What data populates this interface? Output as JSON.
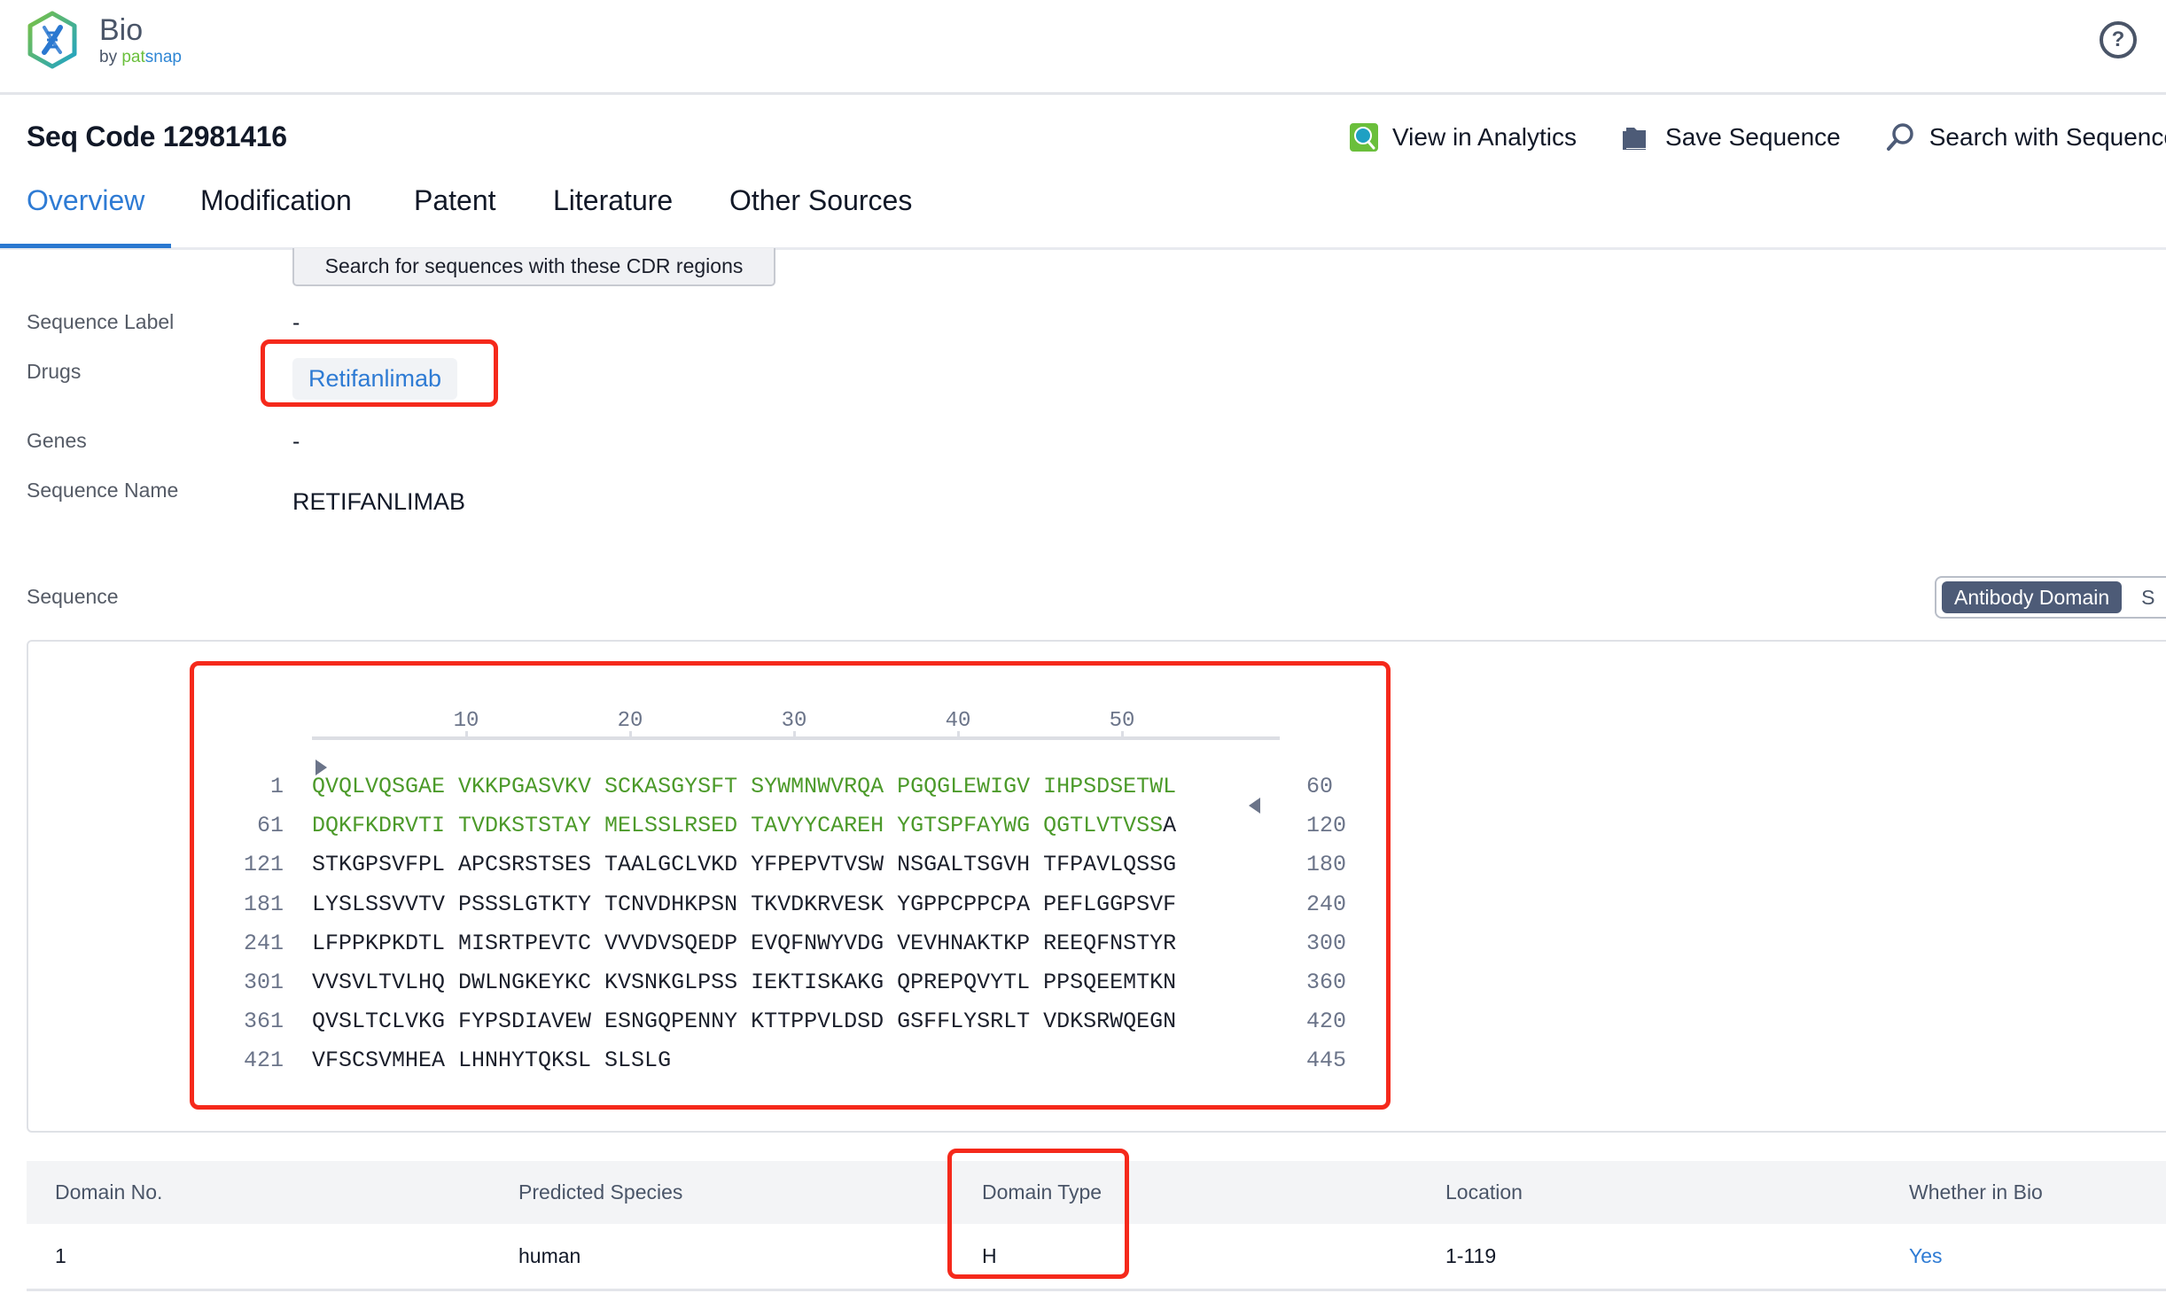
{
  "header": {
    "brand_title": "Bio",
    "brand_by": "by ",
    "brand_pat": "pat",
    "brand_snap": "snap",
    "help_icon": "question-circle-icon"
  },
  "page": {
    "title": "Seq Code 12981416",
    "actions": [
      {
        "label": "View in Analytics",
        "icon": "analytics-magnifier-icon"
      },
      {
        "label": "Save Sequence",
        "icon": "folder-icon"
      },
      {
        "label": "Search with Sequence",
        "icon": "search-icon"
      }
    ]
  },
  "tabs": [
    {
      "label": "Overview",
      "active": true
    },
    {
      "label": "Modification",
      "active": false
    },
    {
      "label": "Patent",
      "active": false
    },
    {
      "label": "Literature",
      "active": false
    },
    {
      "label": "Other Sources",
      "active": false
    }
  ],
  "details": {
    "cdr_button": "Search for sequences with these CDR regions",
    "fields": [
      {
        "label": "Sequence Label",
        "value": "-"
      },
      {
        "label": "Drugs",
        "value": "Retifanlimab"
      },
      {
        "label": "Genes",
        "value": "-"
      },
      {
        "label": "Sequence Name",
        "value": "RETIFANLIMAB"
      }
    ]
  },
  "sequence": {
    "label": "Sequence",
    "view_toggle": {
      "selected": "Antibody Domain",
      "other": "S"
    },
    "ruler_ticks": [
      "10",
      "20",
      "30",
      "40",
      "50"
    ],
    "rows": [
      {
        "start": "1",
        "end": "60",
        "green": "QVQLVQSGAE VKKPGASVKV SCKASGYSFT SYWMNWVRQA PGQGLEWIGV IHPSDSETWL",
        "black": ""
      },
      {
        "start": "61",
        "end": "120",
        "green": "DQKFKDRVTI TVDKSTSTAY MELSSLRSED TAVYYCAREH YGTSPFAYWG QGTLVTVSS",
        "black": "A"
      },
      {
        "start": "121",
        "end": "180",
        "green": "",
        "black": "STKGPSVFPL APCSRSTSES TAALGCLVKD YFPEPVTVSW NSGALTSGVH TFPAVLQSSG"
      },
      {
        "start": "181",
        "end": "240",
        "green": "",
        "black": "LYSLSSVVTV PSSSLGTKTY TCNVDHKPSN TKVDKRVESK YGPPCPPCPA PEFLGGPSVF"
      },
      {
        "start": "241",
        "end": "300",
        "green": "",
        "black": "LFPPKPKDTL MISRTPEVTC VVVDVSQEDP EVQFNWYVDG VEVHNAKTKP REEQFNSTYR"
      },
      {
        "start": "301",
        "end": "360",
        "green": "",
        "black": "VVSVLTVLHQ DWLNGKEYKC KVSNKGLPSS IEKTISKAKG QPREPQVYTL PPSQEEMTKN"
      },
      {
        "start": "361",
        "end": "420",
        "green": "",
        "black": "QVSLTCLVKG FYPSDIAVEW ESNGQPENNY KTTPPVLDSD GSFFLYSRLT VDKSRWQEGN"
      },
      {
        "start": "421",
        "end": "445",
        "green": "",
        "black": "VFSCSVMHEA LHNHYTQKSL SLSLG"
      }
    ],
    "highlight_color": "#4c9a2a"
  },
  "domain_table": {
    "columns": [
      "Domain No.",
      "Predicted Species",
      "Domain Type",
      "Location",
      "Whether in Bio"
    ],
    "rows": [
      [
        "1",
        "human",
        "H",
        "1-119",
        "Yes"
      ]
    ]
  },
  "colors": {
    "accent": "#2e7bd4",
    "annotation": "#f5291b",
    "toggle_active": "#4d5b77"
  }
}
